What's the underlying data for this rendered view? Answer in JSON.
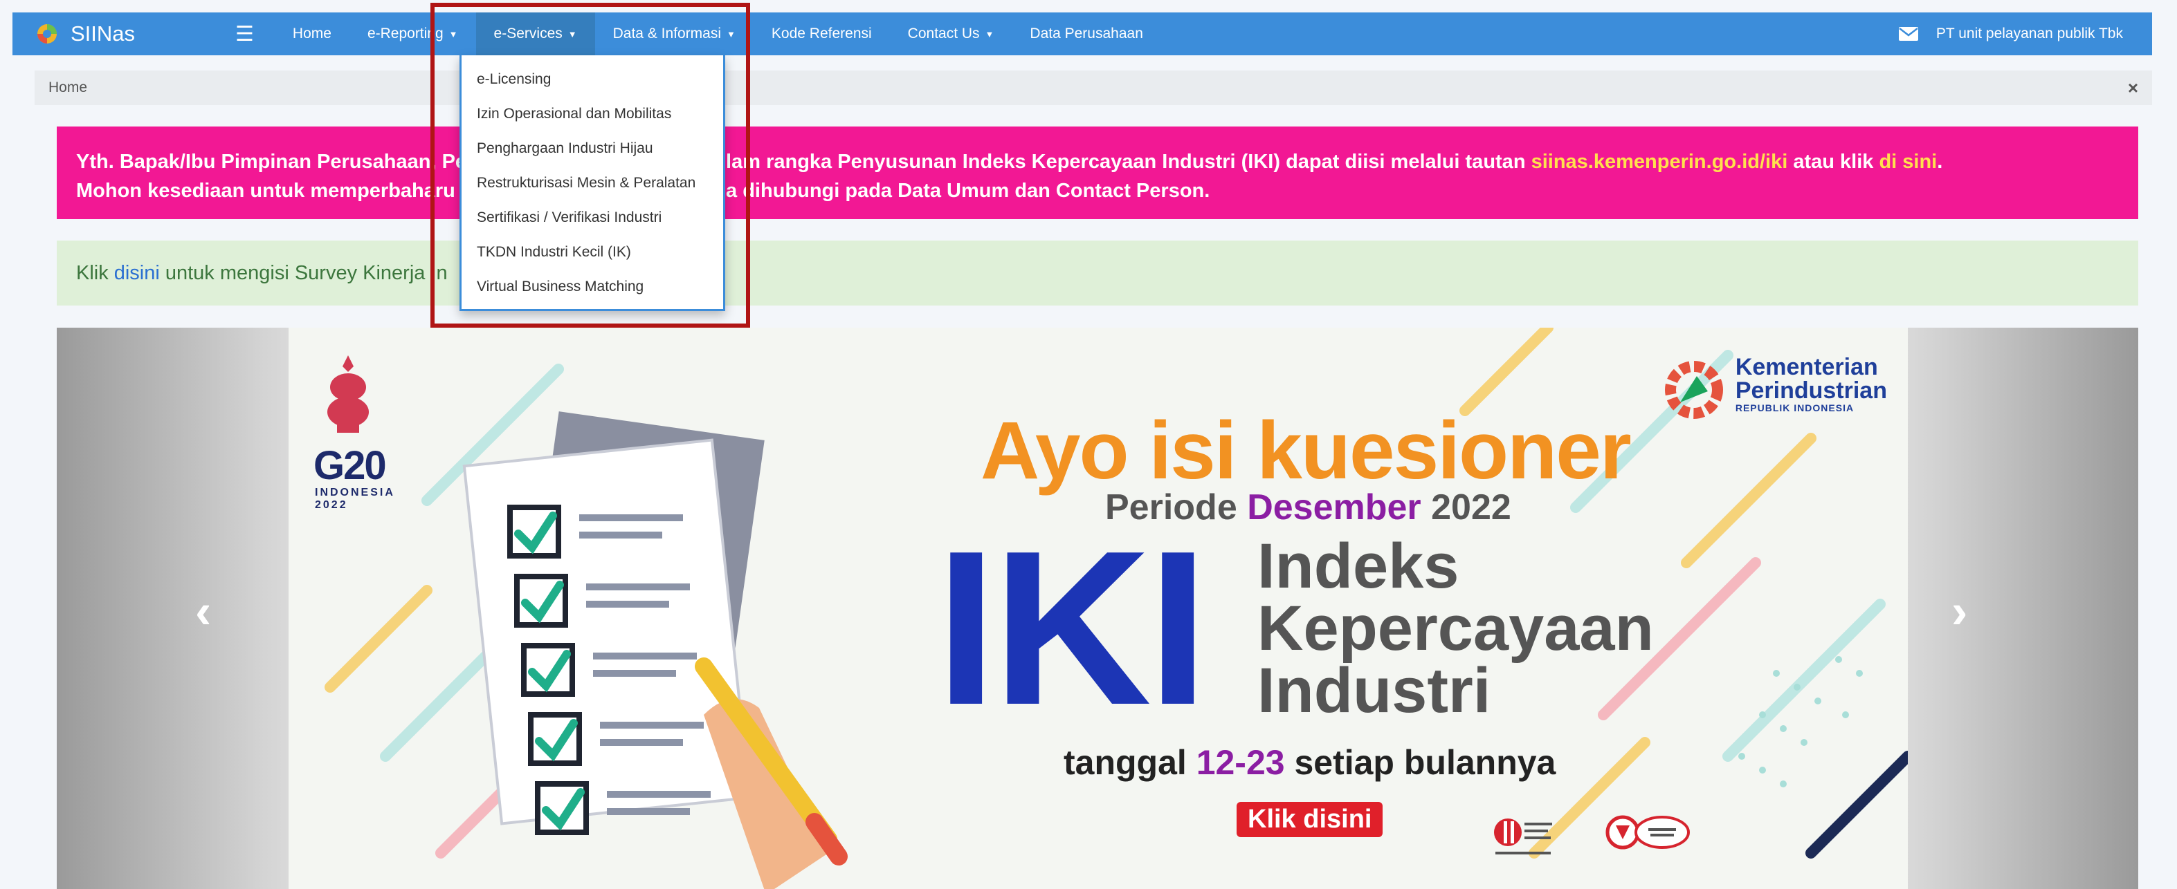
{
  "app": {
    "title": "SIINas"
  },
  "navbar": {
    "items": [
      {
        "label": "Home",
        "has_caret": false
      },
      {
        "label": "e-Reporting",
        "has_caret": true
      },
      {
        "label": "e-Services",
        "has_caret": true,
        "active": true
      },
      {
        "label": "Data & Informasi",
        "has_caret": true
      },
      {
        "label": "Kode Referensi",
        "has_caret": false
      },
      {
        "label": "Contact Us",
        "has_caret": true
      },
      {
        "label": "Data Perusahaan",
        "has_caret": false
      }
    ],
    "user": "PT unit pelayanan publik Tbk",
    "icons": {
      "menu": "hamburger-icon",
      "mail": "envelope-icon",
      "caret": "caret-down-icon"
    }
  },
  "breadcrumb": {
    "current": "Home",
    "close": "×"
  },
  "alerts": {
    "pink": {
      "line1_a": "Yth. Bapak/Ibu Pimpinan Perusahaan, Pe",
      "line1_b": "lam rangka Penyusunan Indeks Kepercayaan Industri (IKI) dapat diisi melalui tautan ",
      "line1_link": "siinas.kemenperin.go.id/iki",
      "line1_c": " atau klik ",
      "line1_link2": "di sini",
      "line1_end": ".",
      "line2_a": "Mohon kesediaan untuk memperbaharu",
      "line2_b": "sa dihubungi pada Data Umum dan Contact Person."
    },
    "green": {
      "prefix": "Klik",
      "link": "disini",
      "suffix": "untuk mengisi Survey Kinerja In"
    }
  },
  "dropdown": {
    "items": [
      "e-Licensing",
      "Izin Operasional dan Mobilitas",
      "Penghargaan Industri Hijau",
      "Restrukturisasi Mesin & Peralatan",
      "Sertifikasi / Verifikasi Industri",
      "TKDN Industri Kecil (IK)",
      "Virtual Business Matching"
    ]
  },
  "banner": {
    "g20": "G20",
    "g20_country": "INDONESIA",
    "g20_year": "2022",
    "ministry_1": "Kementerian",
    "ministry_2": "Perindustrian",
    "ministry_3": "REPUBLIK INDONESIA",
    "headline": "Ayo isi kuesioner",
    "periode_prefix": "Periode ",
    "periode_month": "Desember",
    "periode_year": " 2022",
    "iki": "IKI",
    "iki_word1": "Indeks",
    "iki_word2": "Kepercayaan",
    "iki_word3": "Industri",
    "tanggal_prefix": "tanggal ",
    "tanggal_range": "12-23",
    "tanggal_suffix": " setiap bulannya",
    "button": "Klik disini",
    "prev": "‹",
    "next": "›"
  },
  "colors": {
    "navbar": "#3c8dda",
    "alert_pink": "#f21894",
    "alert_green_bg": "#dff0d8",
    "highlight_box": "#b01515",
    "headline_orange": "#f29222",
    "iki_blue": "#1c35b5"
  }
}
